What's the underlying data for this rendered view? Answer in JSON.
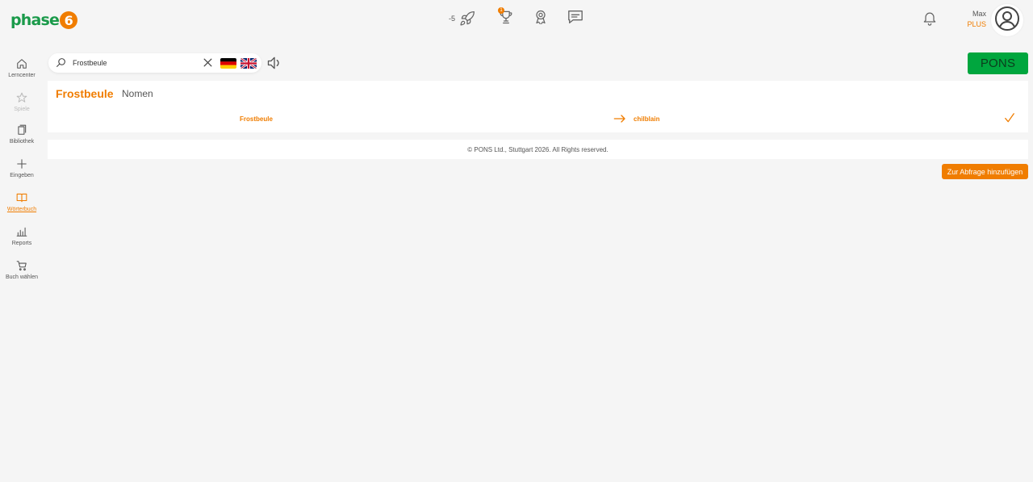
{
  "header": {
    "logo_text": "phase",
    "logo_digit": "6",
    "streak_count": "-5",
    "trophy_badge": "1",
    "icons": [
      "rocket-icon",
      "trophy-icon",
      "award-icon",
      "chat-icon",
      "bell-icon",
      "user-avatar-icon"
    ],
    "user": {
      "name": "Max",
      "plan": "PLUS"
    }
  },
  "sidebar": {
    "items": [
      {
        "label": "Lerncenter",
        "icon": "home-icon",
        "state": "normal"
      },
      {
        "label": "Spiele",
        "icon": "star-icon",
        "state": "disabled"
      },
      {
        "label": "Bibliothek",
        "icon": "library-icon",
        "state": "normal"
      },
      {
        "label": "Eingeben",
        "icon": "plus-icon",
        "state": "normal"
      },
      {
        "label": "Wörterbuch",
        "icon": "book-icon",
        "state": "active"
      },
      {
        "label": "Reports",
        "icon": "bar-chart-icon",
        "state": "normal"
      },
      {
        "label": "Buch wählen",
        "icon": "cart-icon",
        "state": "normal"
      }
    ]
  },
  "search": {
    "value": "Frostbeule",
    "placeholder": ""
  },
  "pons_label": "PONS",
  "result": {
    "headword": "Frostbeule",
    "part_of_speech": "Nomen",
    "source": "Frostbeule",
    "target": "chilblain"
  },
  "footer": {
    "copyright": "© PONS Ltd., Stuttgart 2026. All Rights reserved."
  },
  "add_button_label": "Zur Abfrage hinzufügen",
  "colors": {
    "accent": "#f07d00",
    "brand_green": "#1a9a4a",
    "pons_green": "#00a63e",
    "background": "#f5f5f5"
  }
}
